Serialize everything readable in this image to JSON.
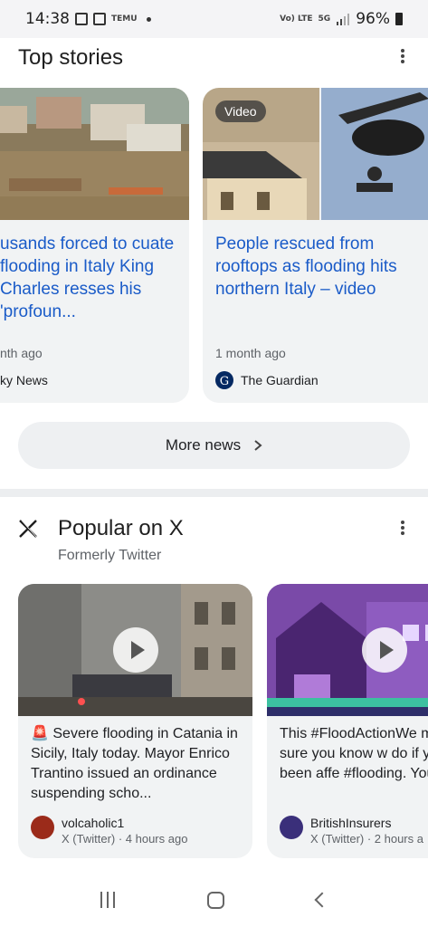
{
  "status_bar": {
    "time": "14:38",
    "battery": "96%",
    "app_label": "TEMU",
    "network_label": "5G"
  },
  "top_stories": {
    "title": "Top stories",
    "cards": [
      {
        "headline": "usands forced to cuate flooding in Italy King Charles resses his 'profoun...",
        "age": "nth ago",
        "source": "ky News"
      },
      {
        "badge": "Video",
        "headline": "People rescued from rooftops as flooding hits northern Italy – video",
        "age": "1 month ago",
        "source": "The Guardian"
      }
    ],
    "more_button": "More news"
  },
  "popular_x": {
    "title": "Popular on X",
    "subtitle": "Formerly Twitter",
    "posts": [
      {
        "text": "🚨 Severe flooding in Catania in Sicily, Italy today. Mayor Enrico Trantino issued an ordinance suspending scho...",
        "author": "volcaholic1",
        "meta": "X (Twitter) · 4 hours ago"
      },
      {
        "text": "This #FloodActionWe make sure you know w do if you've been affe #flooding. You can fir",
        "author": "BritishInsurers",
        "meta": "X (Twitter) · 2 hours a"
      }
    ]
  },
  "colors": {
    "headline": "#1a5bc8",
    "card_bg": "#f1f3f4",
    "muted": "#5f6368"
  }
}
